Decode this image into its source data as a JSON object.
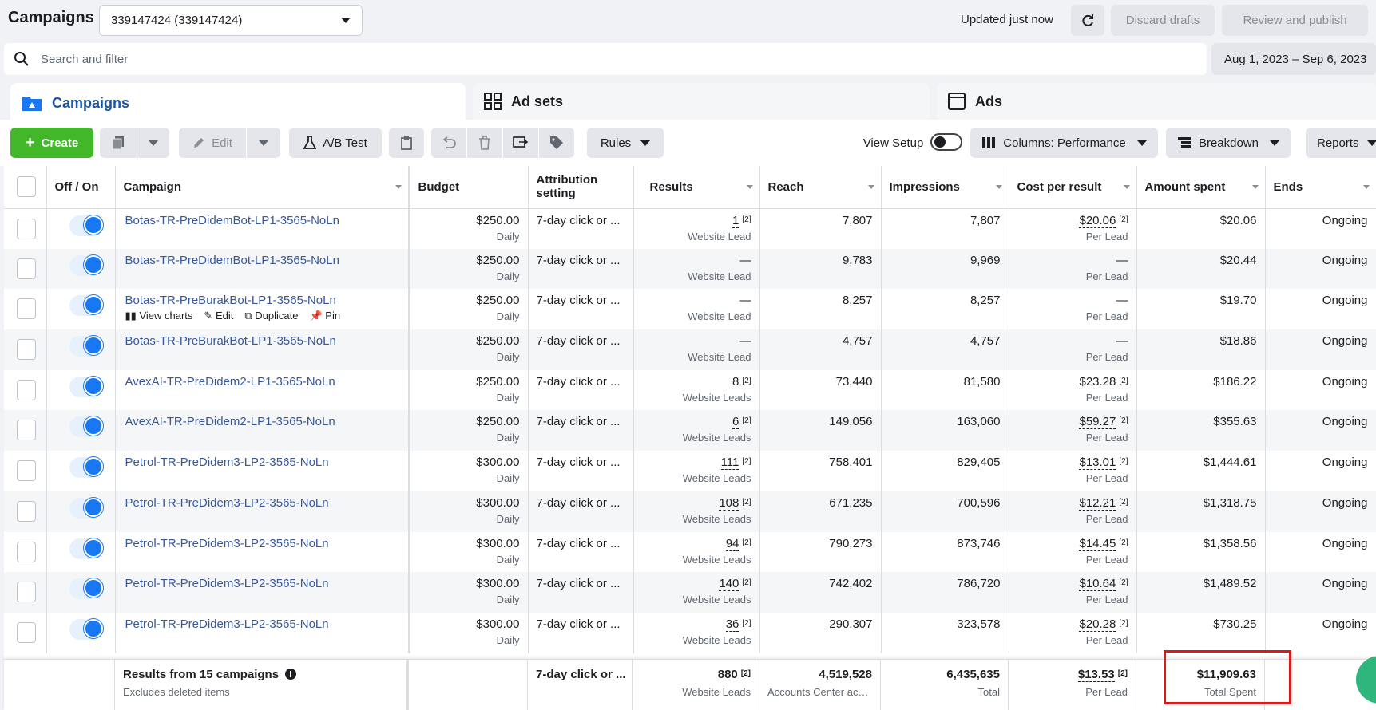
{
  "header": {
    "title": "Campaigns",
    "account": "339147424 (339147424)",
    "updated": "Updated just now",
    "discard": "Discard drafts",
    "review": "Review and publish"
  },
  "search": {
    "placeholder": "Search and filter",
    "date_range": "Aug 1, 2023 – Sep 6, 2023"
  },
  "tabs": [
    {
      "label": "Campaigns",
      "active": true
    },
    {
      "label": "Ad sets",
      "active": false
    },
    {
      "label": "Ads",
      "active": false
    }
  ],
  "toolbar": {
    "create": "Create",
    "edit": "Edit",
    "ab_test": "A/B Test",
    "rules": "Rules",
    "view_setup": "View Setup",
    "columns": "Columns: Performance",
    "breakdown": "Breakdown",
    "reports": "Reports"
  },
  "columns": {
    "off_on": "Off / On",
    "campaign": "Campaign",
    "budget": "Budget",
    "attribution": "Attribution setting",
    "results": "Results",
    "reach": "Reach",
    "impressions": "Impressions",
    "cost_per_result": "Cost per result",
    "amount_spent": "Amount spent",
    "ends": "Ends"
  },
  "row_actions": {
    "view_charts": "View charts",
    "edit": "Edit",
    "duplicate": "Duplicate",
    "pin": "Pin"
  },
  "rows": [
    {
      "name": "Botas-TR-PreDidemBot-LP1-3565-NoLn",
      "budget": "$250.00",
      "budget_type": "Daily",
      "attribution": "7-day click or ...",
      "results": "1",
      "results_label": "Website Lead",
      "reach": "7,807",
      "impressions": "7,807",
      "cpr": "$20.06",
      "cpr_label": "Per Lead",
      "spent": "$20.06",
      "ends": "Ongoing"
    },
    {
      "name": "Botas-TR-PreDidemBot-LP1-3565-NoLn",
      "budget": "$250.00",
      "budget_type": "Daily",
      "attribution": "7-day click or ...",
      "results": "—",
      "results_label": "Website Lead",
      "reach": "9,783",
      "impressions": "9,969",
      "cpr": "—",
      "cpr_label": "Per Lead",
      "spent": "$20.44",
      "ends": "Ongoing"
    },
    {
      "name": "Botas-TR-PreBurakBot-LP1-3565-NoLn",
      "budget": "$250.00",
      "budget_type": "Daily",
      "attribution": "7-day click or ...",
      "results": "—",
      "results_label": "Website Lead",
      "reach": "8,257",
      "impressions": "8,257",
      "cpr": "—",
      "cpr_label": "Per Lead",
      "spent": "$19.70",
      "ends": "Ongoing"
    },
    {
      "name": "Botas-TR-PreBurakBot-LP1-3565-NoLn",
      "budget": "$250.00",
      "budget_type": "Daily",
      "attribution": "7-day click or ...",
      "results": "—",
      "results_label": "Website Lead",
      "reach": "4,757",
      "impressions": "4,757",
      "cpr": "—",
      "cpr_label": "Per Lead",
      "spent": "$18.86",
      "ends": "Ongoing"
    },
    {
      "name": "AvexAI-TR-PreDidem2-LP1-3565-NoLn",
      "budget": "$250.00",
      "budget_type": "Daily",
      "attribution": "7-day click or ...",
      "results": "8",
      "results_label": "Website Leads",
      "reach": "73,440",
      "impressions": "81,580",
      "cpr": "$23.28",
      "cpr_label": "Per Lead",
      "spent": "$186.22",
      "ends": "Ongoing"
    },
    {
      "name": "AvexAI-TR-PreDidem2-LP1-3565-NoLn",
      "budget": "$250.00",
      "budget_type": "Daily",
      "attribution": "7-day click or ...",
      "results": "6",
      "results_label": "Website Leads",
      "reach": "149,056",
      "impressions": "163,060",
      "cpr": "$59.27",
      "cpr_label": "Per Lead",
      "spent": "$355.63",
      "ends": "Ongoing"
    },
    {
      "name": "Petrol-TR-PreDidem3-LP2-3565-NoLn",
      "budget": "$300.00",
      "budget_type": "Daily",
      "attribution": "7-day click or ...",
      "results": "111",
      "results_label": "Website Leads",
      "reach": "758,401",
      "impressions": "829,405",
      "cpr": "$13.01",
      "cpr_label": "Per Lead",
      "spent": "$1,444.61",
      "ends": "Ongoing"
    },
    {
      "name": "Petrol-TR-PreDidem3-LP2-3565-NoLn",
      "budget": "$300.00",
      "budget_type": "Daily",
      "attribution": "7-day click or ...",
      "results": "108",
      "results_label": "Website Leads",
      "reach": "671,235",
      "impressions": "700,596",
      "cpr": "$12.21",
      "cpr_label": "Per Lead",
      "spent": "$1,318.75",
      "ends": "Ongoing"
    },
    {
      "name": "Petrol-TR-PreDidem3-LP2-3565-NoLn",
      "budget": "$300.00",
      "budget_type": "Daily",
      "attribution": "7-day click or ...",
      "results": "94",
      "results_label": "Website Leads",
      "reach": "790,273",
      "impressions": "873,746",
      "cpr": "$14.45",
      "cpr_label": "Per Lead",
      "spent": "$1,358.56",
      "ends": "Ongoing"
    },
    {
      "name": "Petrol-TR-PreDidem3-LP2-3565-NoLn",
      "budget": "$300.00",
      "budget_type": "Daily",
      "attribution": "7-day click or ...",
      "results": "140",
      "results_label": "Website Leads",
      "reach": "742,402",
      "impressions": "786,720",
      "cpr": "$10.64",
      "cpr_label": "Per Lead",
      "spent": "$1,489.52",
      "ends": "Ongoing"
    },
    {
      "name": "Petrol-TR-PreDidem3-LP2-3565-NoLn",
      "budget": "$300.00",
      "budget_type": "Daily",
      "attribution": "7-day click or ...",
      "results": "36",
      "results_label": "Website Leads",
      "reach": "290,307",
      "impressions": "323,578",
      "cpr": "$20.28",
      "cpr_label": "Per Lead",
      "spent": "$730.25",
      "ends": "Ongoing"
    }
  ],
  "footer": {
    "title": "Results from 15 campaigns",
    "subtitle": "Excludes deleted items",
    "attribution": "7-day click or ...",
    "results": "880",
    "results_label": "Website Leads",
    "reach": "4,519,528",
    "reach_label": "Accounts Center acco...",
    "impressions": "6,435,635",
    "impressions_label": "Total",
    "cpr": "$13.53",
    "cpr_label": "Per Lead",
    "spent": "$11,909.63",
    "spent_label": "Total Spent"
  },
  "sup_marker": "[2]",
  "colors": {
    "accent": "#1877f2",
    "create": "#42b72a",
    "link": "#385898",
    "highlight": "#e0181b"
  }
}
